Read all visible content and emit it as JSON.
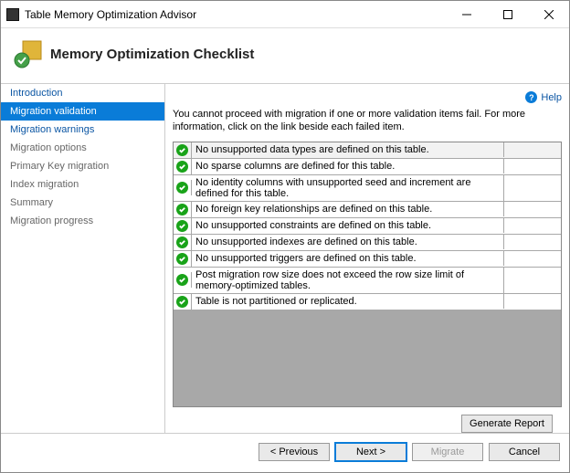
{
  "window": {
    "title": "Table Memory Optimization Advisor"
  },
  "header": {
    "heading": "Memory Optimization Checklist"
  },
  "sidebar": {
    "items": [
      {
        "label": "Introduction",
        "state": "link"
      },
      {
        "label": "Migration validation",
        "state": "selected"
      },
      {
        "label": "Migration warnings",
        "state": "link"
      },
      {
        "label": "Migration options",
        "state": "dim"
      },
      {
        "label": "Primary Key migration",
        "state": "dim"
      },
      {
        "label": "Index migration",
        "state": "dim"
      },
      {
        "label": "Summary",
        "state": "dim"
      },
      {
        "label": "Migration progress",
        "state": "dim"
      }
    ]
  },
  "content": {
    "help_label": "Help",
    "instruction": "You cannot proceed with migration if one or more validation items fail. For more information, click on the link beside each failed item.",
    "checks": [
      "No unsupported data types are defined on this table.",
      "No sparse columns are defined for this table.",
      "No identity columns with unsupported seed and increment are defined for this table.",
      "No foreign key relationships are defined on this table.",
      "No unsupported constraints are defined on this table.",
      "No unsupported indexes are defined on this table.",
      "No unsupported triggers are defined on this table.",
      "Post migration row size does not exceed the row size limit of memory-optimized tables.",
      "Table is not partitioned or replicated."
    ]
  },
  "buttons": {
    "generate_report": "Generate Report",
    "previous": "< Previous",
    "next": "Next >",
    "migrate": "Migrate",
    "cancel": "Cancel"
  }
}
